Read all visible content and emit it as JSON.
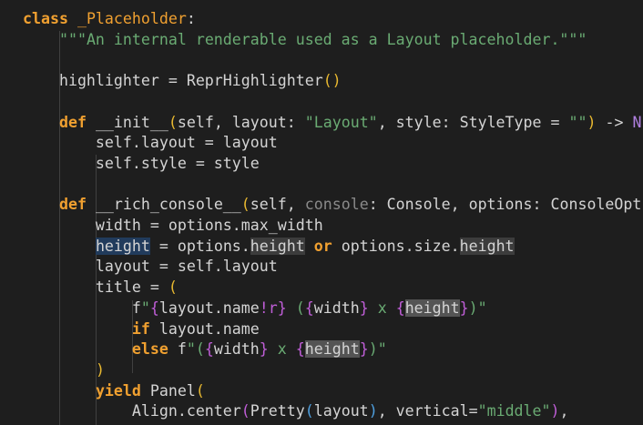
{
  "editor": {
    "language": "python",
    "lines": [
      [
        {
          "t": "class",
          "c": "kw"
        },
        {
          "t": " "
        },
        {
          "t": "_Placeholder",
          "c": "cls"
        },
        {
          "t": ":"
        }
      ],
      [
        {
          "t": "    "
        },
        {
          "t": "\"\"\"An internal renderable used as a Layout placeholder.\"\"\"",
          "c": "doc"
        }
      ],
      [],
      [
        {
          "t": "    highlighter = ReprHighlighter"
        },
        {
          "t": "()",
          "c": "par"
        }
      ],
      [],
      [
        {
          "t": "    "
        },
        {
          "t": "def",
          "c": "kw"
        },
        {
          "t": " __init__"
        },
        {
          "t": "(",
          "c": "par"
        },
        {
          "t": "self, layout: "
        },
        {
          "t": "\"Layout\"",
          "c": "str"
        },
        {
          "t": ", style: StyleType = "
        },
        {
          "t": "\"\"",
          "c": "str"
        },
        {
          "t": ")",
          "c": "par"
        },
        {
          "t": " -> "
        },
        {
          "t": "N",
          "c": "ov"
        }
      ],
      [
        {
          "t": "        self.layout = layout"
        }
      ],
      [
        {
          "t": "        self.style = style"
        }
      ],
      [],
      [
        {
          "t": "    "
        },
        {
          "t": "def",
          "c": "kw"
        },
        {
          "t": " __rich_console__"
        },
        {
          "t": "(",
          "c": "par"
        },
        {
          "t": "self, "
        },
        {
          "t": "console",
          "c": "muted"
        },
        {
          "t": ": Console, options: ConsoleOpt"
        }
      ],
      [
        {
          "t": "        width = options.max_width"
        }
      ],
      [
        {
          "t": "        "
        },
        {
          "t": "height",
          "c": "hl-sel"
        },
        {
          "t": " = options."
        },
        {
          "t": "height",
          "c": "hl-occ"
        },
        {
          "t": " "
        },
        {
          "t": "or",
          "c": "kw"
        },
        {
          "t": " options.size."
        },
        {
          "t": "height",
          "c": "hl-occ"
        }
      ],
      [
        {
          "t": "        layout = self.layout"
        }
      ],
      [
        {
          "t": "        title = "
        },
        {
          "t": "(",
          "c": "par"
        }
      ],
      [
        {
          "t": "            f"
        },
        {
          "t": "\"",
          "c": "str"
        },
        {
          "t": "{",
          "c": "brace"
        },
        {
          "t": "layout.name"
        },
        {
          "t": "!r",
          "c": "brace"
        },
        {
          "t": "}",
          "c": "brace"
        },
        {
          "t": " (",
          "c": "str"
        },
        {
          "t": "{",
          "c": "brace"
        },
        {
          "t": "width"
        },
        {
          "t": "}",
          "c": "brace"
        },
        {
          "t": " x ",
          "c": "str"
        },
        {
          "t": "{",
          "c": "brace"
        },
        {
          "t": "height",
          "c": "hl-occ2"
        },
        {
          "t": "}",
          "c": "brace"
        },
        {
          "t": ")\"",
          "c": "str"
        }
      ],
      [
        {
          "t": "            "
        },
        {
          "t": "if",
          "c": "kw"
        },
        {
          "t": " layout.name"
        }
      ],
      [
        {
          "t": "            "
        },
        {
          "t": "else",
          "c": "kw"
        },
        {
          "t": " f"
        },
        {
          "t": "\"(",
          "c": "str"
        },
        {
          "t": "{",
          "c": "brace"
        },
        {
          "t": "width"
        },
        {
          "t": "}",
          "c": "brace"
        },
        {
          "t": " x ",
          "c": "str"
        },
        {
          "t": "{",
          "c": "brace"
        },
        {
          "t": "height",
          "c": "hl-occ2"
        },
        {
          "t": "}",
          "c": "brace"
        },
        {
          "t": ")\"",
          "c": "str"
        }
      ],
      [
        {
          "t": "        "
        },
        {
          "t": ")",
          "c": "par"
        }
      ],
      [
        {
          "t": "        "
        },
        {
          "t": "yield",
          "c": "kw"
        },
        {
          "t": " Panel"
        },
        {
          "t": "(",
          "c": "par"
        }
      ],
      [
        {
          "t": "            Align.center"
        },
        {
          "t": "(",
          "c": "brace"
        },
        {
          "t": "Pretty"
        },
        {
          "t": "(",
          "c": "par2"
        },
        {
          "t": "layout"
        },
        {
          "t": ")",
          "c": "par2"
        },
        {
          "t": ", vertical="
        },
        {
          "t": "\"middle\"",
          "c": "str"
        },
        {
          "t": ")",
          "c": "brace"
        },
        {
          "t": ","
        }
      ]
    ]
  }
}
